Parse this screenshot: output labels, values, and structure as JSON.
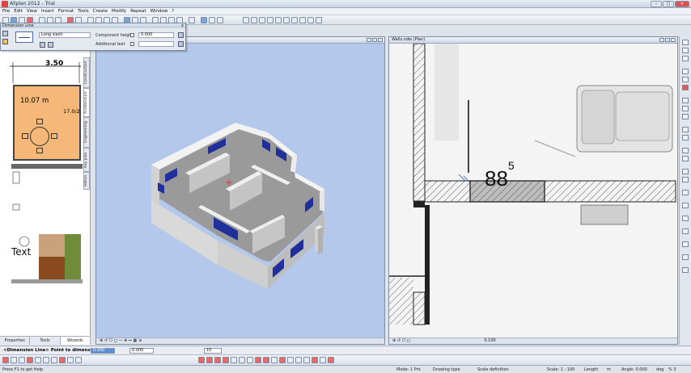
{
  "window": {
    "title": "Allplan 2012 - Trial"
  },
  "menu": [
    "File",
    "Edit",
    "View",
    "Insert",
    "Format",
    "Tools",
    "Create",
    "Modify",
    "Repeat",
    "Window",
    "?"
  ],
  "dimension_dialog": {
    "title": "Dimension Line",
    "close": "x",
    "style_select": "Long slash",
    "component_height_label": "Component height",
    "component_height_value": "0.000",
    "additional_text_label": "Additional text"
  },
  "left_panel": {
    "tabs_vertical": [
      "Construction",
      "Architecture",
      "Engineering",
      "Key plan",
      "Admin"
    ],
    "dimension": "3.50",
    "room_area": "10.07 m",
    "room_label": "17.0/2",
    "text_sample": "Text",
    "bottom_tabs": [
      "Properties",
      "Tools",
      "Wizards"
    ]
  },
  "viewport_3d": {
    "title": "",
    "status": ""
  },
  "viewport_plan": {
    "title": "Walls.ndw (Plan)",
    "dimension_main": "88",
    "dimension_sup": "5",
    "zoom_value": "0.100"
  },
  "dialog_line": {
    "prompt": "<Dimension Line> Point to dimension",
    "value_1": "0.000",
    "value_2": "0.000",
    "value_3": "10"
  },
  "status_bar": {
    "help": "Press F1 to get Help",
    "mode": "Mode: 1 Pnt",
    "drawing_type": "Drawing type",
    "scale_def": "Scale definition",
    "scale": "Scale: 1 : 100",
    "length": "Length",
    "unit": "m",
    "angle": "Angle: 0.000",
    "deg": "deg",
    "percent": "% 3"
  },
  "colors": {
    "viewport_3d_bg": "#b4c8ec",
    "room_fill": "#f5b878",
    "accent": "#2a4f9a"
  }
}
